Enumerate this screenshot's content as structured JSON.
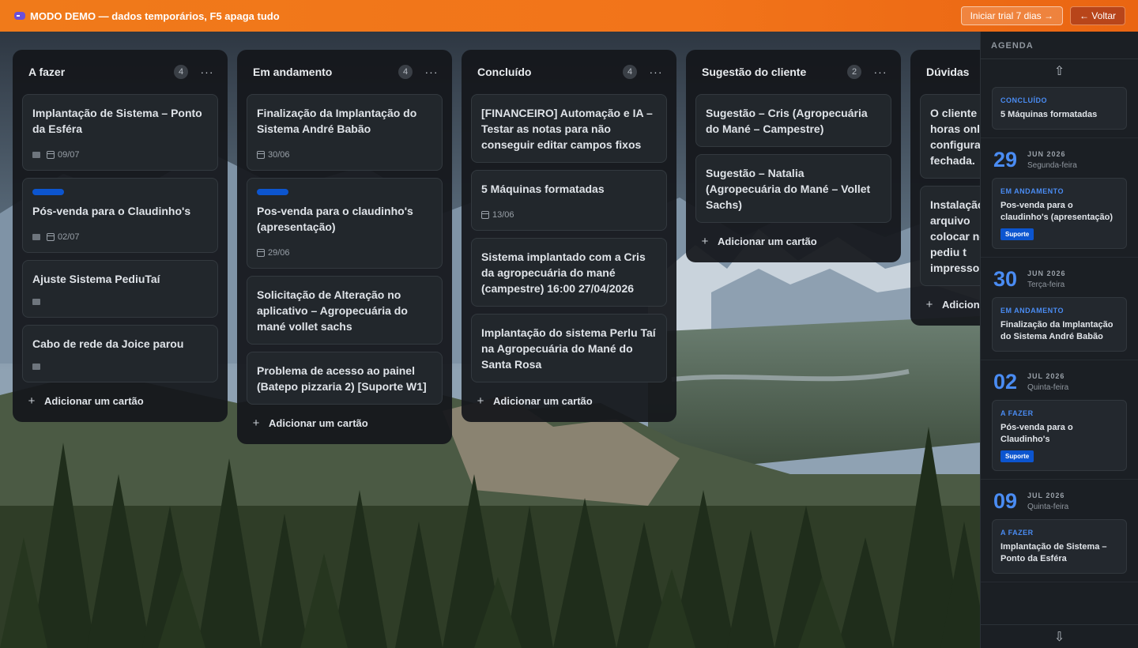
{
  "banner": {
    "text": "MODO DEMO — dados temporários, F5 apaga tudo",
    "trial_label": "Iniciar trial 7 dias →",
    "back_label": "← Voltar"
  },
  "lists": [
    {
      "title": "A fazer",
      "count": "4",
      "menu": "···",
      "cards": [
        {
          "title": "Implantação de Sistema – Ponto da Esféra",
          "date": "09/07"
        },
        {
          "title": "Pós-venda para o Claudinho's",
          "date": "02/07"
        },
        {
          "title": "Ajuste Sistema PediuTaí"
        },
        {
          "title": "Cabo de rede da Joice parou"
        }
      ],
      "add_label": "Adicionar um cartão"
    },
    {
      "title": "Em andamento",
      "count": "4",
      "menu": "···",
      "cards": [
        {
          "title": "Finalização da Implantação do Sistema André Babão",
          "date": "30/06"
        },
        {
          "title": "Pos-venda para o claudinho's (apresentação)",
          "date": "29/06"
        },
        {
          "title": "Solicitação de Alteração no aplicativo – Agropecuária do mané vollet sachs"
        },
        {
          "title": "Problema de acesso ao painel (Batepo pizzaria 2) [Suporte W1]"
        }
      ],
      "add_label": "Adicionar um cartão"
    },
    {
      "title": "Concluído",
      "count": "4",
      "menu": "···",
      "cards": [
        {
          "title": "[FINANCEIRO] Automação e IA – Testar as notas para não conseguir editar campos fixos"
        },
        {
          "title": "5 Máquinas formatadas",
          "date": "13/06"
        },
        {
          "title": "Sistema implantado com a Cris da agropecuária do mané (campestre) 16:00 27/04/2026"
        },
        {
          "title": "Implantação do sistema Perlu Taí na Agropecuária do Mané do Santa Rosa"
        }
      ],
      "add_label": "Adicionar um cartão"
    },
    {
      "title": "Sugestão do cliente",
      "count": "2",
      "menu": "···",
      "cards": [
        {
          "title": "Sugestão – Cris (Agropecuária do Mané – Campestre)"
        },
        {
          "title": "Sugestão – Natalia (Agropecuária do Mané – Vollet Sachs)"
        }
      ],
      "add_label": "Adicionar um cartão"
    },
    {
      "title": "Dúvidas",
      "cards": [
        {
          "title": "O cliente d horas onli configura fechada."
        },
        {
          "title": "Instalação o arquivo colocar no do pediu t impresson"
        }
      ],
      "add_label": "Adiciona"
    }
  ],
  "agenda": {
    "title": "AGENDA",
    "up_icon": "⇧",
    "down_icon": "⇩",
    "top_item": {
      "status": "CONCLUÍDO",
      "title": "5 Máquinas formatadas"
    },
    "days": [
      {
        "day": "29",
        "month": "JUN 2026",
        "weekday": "Segunda-feira",
        "item": {
          "status": "EM ANDAMENTO",
          "title": "Pos-venda para o claudinho's (apresentação)",
          "tag": "Suporte"
        }
      },
      {
        "day": "30",
        "month": "JUN 2026",
        "weekday": "Terça-feira",
        "item": {
          "status": "EM ANDAMENTO",
          "title": "Finalização da Implantação do Sistema André Babão"
        }
      },
      {
        "day": "02",
        "month": "JUL 2026",
        "weekday": "Quinta-feira",
        "item": {
          "status": "A FAZER",
          "title": "Pós-venda para o Claudinho's",
          "tag": "Suporte"
        }
      },
      {
        "day": "09",
        "month": "JUL 2026",
        "weekday": "Quinta-feira",
        "item": {
          "status": "A FAZER",
          "title": "Implantação de Sistema – Ponto da Esféra"
        }
      }
    ]
  },
  "colors": {
    "banner_orange": "#f2741a",
    "label_blue": "#0c55cf",
    "agenda_blue": "#4a8cf3"
  }
}
